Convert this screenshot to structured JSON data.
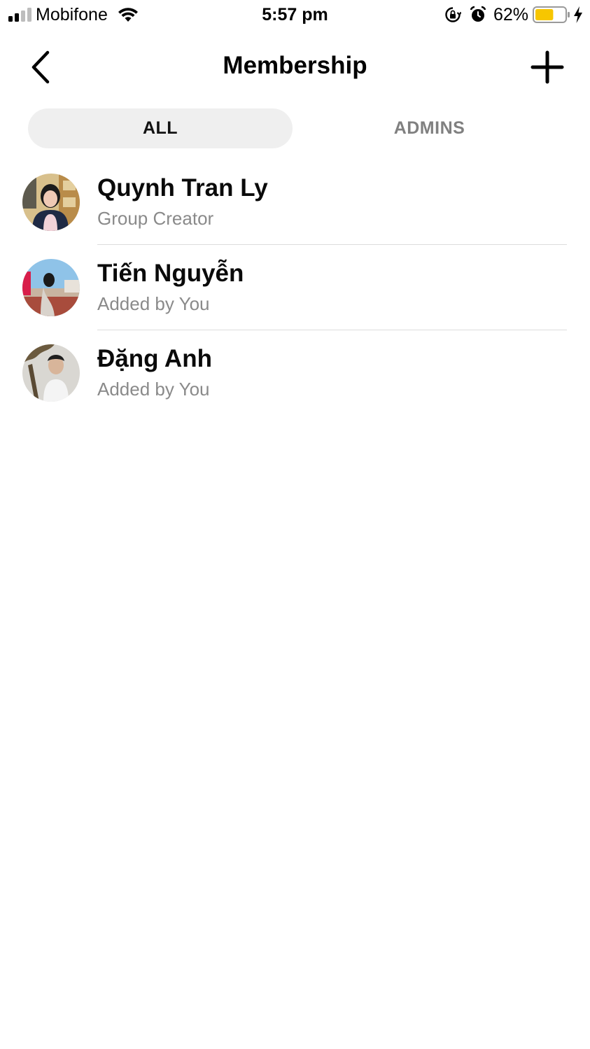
{
  "status_bar": {
    "carrier": "Mobifone",
    "time": "5:57 pm",
    "battery_percent": "62%",
    "battery_level": 0.62,
    "battery_color": "#f7c600",
    "icons": [
      "signal-icon",
      "wifi-icon",
      "rotation-lock-icon",
      "alarm-icon",
      "battery-icon",
      "charging-bolt-icon"
    ]
  },
  "nav": {
    "title": "Membership",
    "back_icon": "chevron-left-icon",
    "add_icon": "plus-icon"
  },
  "tabs": [
    {
      "label": "ALL",
      "selected": true
    },
    {
      "label": "ADMINS",
      "selected": false
    }
  ],
  "members": [
    {
      "name": "Quynh Tran Ly",
      "subtitle": "Group Creator"
    },
    {
      "name": "Tiến Nguyễn",
      "subtitle": "Added by You"
    },
    {
      "name": "Đặng Anh",
      "subtitle": "Added by You"
    }
  ]
}
